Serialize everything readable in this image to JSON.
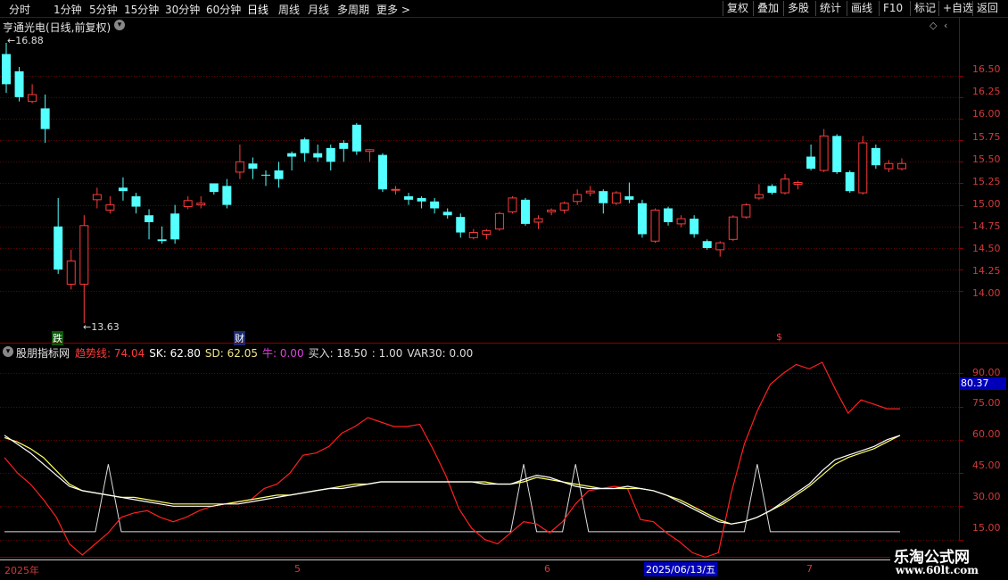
{
  "toolbar": {
    "periods": [
      "分时",
      "1分钟",
      "5分钟",
      "15分钟",
      "30分钟",
      "60分钟",
      "日线",
      "周线",
      "月线",
      "多周期",
      "更多"
    ],
    "active_period": "日线",
    "right_buttons": [
      "复权",
      "叠加",
      "多股",
      "统计",
      "画线",
      "F10",
      "标记",
      "+自选",
      "返回"
    ]
  },
  "header": {
    "title": "亨通光电(日线,前复权)"
  },
  "price_axis": [
    "16.50",
    "16.25",
    "16.00",
    "15.75",
    "15.50",
    "15.25",
    "15.00",
    "14.75",
    "14.50",
    "14.25",
    "14.00"
  ],
  "annotations": {
    "high": "16.88",
    "low": "13.63",
    "chip_die": "跌",
    "chip_cai": "财",
    "chip_s": "$"
  },
  "indicator": {
    "name": "股朋指标网",
    "fields": [
      {
        "label": "趋势线:",
        "value": "74.04",
        "color": "#ff3b3b"
      },
      {
        "label": "SK:",
        "value": "62.80",
        "color": "#ffffff"
      },
      {
        "label": "SD:",
        "value": "62.05",
        "color": "#f0e68c"
      },
      {
        "label": "牛:",
        "value": "0.00",
        "color": "#e040e0"
      },
      {
        "label": "买入:",
        "value": "18.50",
        "color": "#dddddd"
      },
      {
        "label": ":",
        "value": "1.00",
        "color": "#dddddd"
      },
      {
        "label": "VAR30:",
        "value": "0.00",
        "color": "#dddddd"
      }
    ],
    "axis": [
      "90.00",
      "75.00",
      "60.00",
      "45.00",
      "30.00",
      "15.00"
    ],
    "current": "80.37"
  },
  "time_axis": {
    "labels": [
      "2025年",
      "5",
      "6",
      "7"
    ],
    "cursor_date": "2025/06/13/五"
  },
  "watermark": {
    "line1": "乐淘公式网",
    "line2": "www.60lt.com"
  },
  "colors": {
    "up": "#ff3b3b",
    "down": "#54ffff",
    "trend": "#ff2020",
    "sk": "#ffffff",
    "sd": "#ffff66"
  },
  "chart_data": [
    {
      "type": "candlestick",
      "title": "亨通光电(日线,前复权)",
      "ylim": [
        13.6,
        16.9
      ],
      "candles": [
        {
          "o": 16.75,
          "c": 16.4,
          "h": 16.88,
          "l": 16.3
        },
        {
          "o": 16.55,
          "c": 16.25,
          "h": 16.6,
          "l": 16.2
        },
        {
          "o": 16.2,
          "c": 16.28,
          "h": 16.4,
          "l": 16.18
        },
        {
          "o": 16.12,
          "c": 15.88,
          "h": 16.28,
          "l": 15.72
        },
        {
          "o": 14.75,
          "c": 14.25,
          "h": 15.08,
          "l": 14.2
        },
        {
          "o": 14.08,
          "c": 14.35,
          "h": 14.48,
          "l": 14.02
        },
        {
          "o": 14.08,
          "c": 14.76,
          "h": 14.88,
          "l": 13.63
        },
        {
          "o": 15.06,
          "c": 15.12,
          "h": 15.2,
          "l": 14.96
        },
        {
          "o": 14.94,
          "c": 15.0,
          "h": 15.1,
          "l": 14.9
        },
        {
          "o": 15.2,
          "c": 15.16,
          "h": 15.32,
          "l": 15.05
        },
        {
          "o": 15.1,
          "c": 14.98,
          "h": 15.14,
          "l": 14.9
        },
        {
          "o": 14.88,
          "c": 14.8,
          "h": 14.95,
          "l": 14.6
        },
        {
          "o": 14.6,
          "c": 14.58,
          "h": 14.75,
          "l": 14.55
        },
        {
          "o": 14.9,
          "c": 14.6,
          "h": 15.0,
          "l": 14.55
        },
        {
          "o": 14.98,
          "c": 15.05,
          "h": 15.1,
          "l": 14.95
        },
        {
          "o": 15.0,
          "c": 15.02,
          "h": 15.1,
          "l": 14.96
        },
        {
          "o": 15.25,
          "c": 15.15,
          "h": 15.25,
          "l": 15.12
        },
        {
          "o": 15.22,
          "c": 15.0,
          "h": 15.3,
          "l": 14.96
        },
        {
          "o": 15.38,
          "c": 15.5,
          "h": 15.7,
          "l": 15.3
        },
        {
          "o": 15.48,
          "c": 15.42,
          "h": 15.55,
          "l": 15.3
        },
        {
          "o": 15.35,
          "c": 15.34,
          "h": 15.4,
          "l": 15.22
        },
        {
          "o": 15.4,
          "c": 15.3,
          "h": 15.5,
          "l": 15.2
        },
        {
          "o": 15.6,
          "c": 15.56,
          "h": 15.62,
          "l": 15.4
        },
        {
          "o": 15.76,
          "c": 15.6,
          "h": 15.78,
          "l": 15.5
        },
        {
          "o": 15.6,
          "c": 15.55,
          "h": 15.7,
          "l": 15.5
        },
        {
          "o": 15.66,
          "c": 15.5,
          "h": 15.7,
          "l": 15.4
        },
        {
          "o": 15.72,
          "c": 15.65,
          "h": 15.75,
          "l": 15.5
        },
        {
          "o": 15.93,
          "c": 15.62,
          "h": 15.95,
          "l": 15.58
        },
        {
          "o": 15.62,
          "c": 15.64,
          "h": 15.65,
          "l": 15.5
        },
        {
          "o": 15.58,
          "c": 15.18,
          "h": 15.6,
          "l": 15.15
        },
        {
          "o": 15.18,
          "c": 15.18,
          "h": 15.22,
          "l": 15.12
        },
        {
          "o": 15.1,
          "c": 15.06,
          "h": 15.14,
          "l": 15.0
        },
        {
          "o": 15.08,
          "c": 15.04,
          "h": 15.1,
          "l": 14.96
        },
        {
          "o": 15.04,
          "c": 14.96,
          "h": 15.08,
          "l": 14.9
        },
        {
          "o": 14.92,
          "c": 14.88,
          "h": 14.96,
          "l": 14.84
        },
        {
          "o": 14.86,
          "c": 14.68,
          "h": 14.9,
          "l": 14.62
        },
        {
          "o": 14.62,
          "c": 14.68,
          "h": 14.72,
          "l": 14.6
        },
        {
          "o": 14.66,
          "c": 14.7,
          "h": 14.72,
          "l": 14.6
        },
        {
          "o": 14.72,
          "c": 14.9,
          "h": 14.92,
          "l": 14.7
        },
        {
          "o": 14.92,
          "c": 15.08,
          "h": 15.1,
          "l": 14.9
        },
        {
          "o": 15.06,
          "c": 14.78,
          "h": 15.08,
          "l": 14.76
        },
        {
          "o": 14.8,
          "c": 14.84,
          "h": 14.88,
          "l": 14.72
        },
        {
          "o": 14.92,
          "c": 14.94,
          "h": 14.96,
          "l": 14.88
        },
        {
          "o": 14.94,
          "c": 15.02,
          "h": 15.04,
          "l": 14.9
        },
        {
          "o": 15.04,
          "c": 15.12,
          "h": 15.18,
          "l": 15.0
        },
        {
          "o": 15.14,
          "c": 15.16,
          "h": 15.22,
          "l": 15.1
        },
        {
          "o": 15.16,
          "c": 15.02,
          "h": 15.18,
          "l": 14.9
        },
        {
          "o": 15.02,
          "c": 15.14,
          "h": 15.16,
          "l": 15.0
        },
        {
          "o": 15.1,
          "c": 15.06,
          "h": 15.26,
          "l": 15.02
        },
        {
          "o": 15.02,
          "c": 14.66,
          "h": 15.06,
          "l": 14.62
        },
        {
          "o": 14.58,
          "c": 14.94,
          "h": 14.96,
          "l": 14.56
        },
        {
          "o": 14.96,
          "c": 14.8,
          "h": 14.98,
          "l": 14.76
        },
        {
          "o": 14.78,
          "c": 14.84,
          "h": 14.88,
          "l": 14.74
        },
        {
          "o": 14.84,
          "c": 14.66,
          "h": 14.88,
          "l": 14.62
        },
        {
          "o": 14.58,
          "c": 14.5,
          "h": 14.6,
          "l": 14.48
        },
        {
          "o": 14.48,
          "c": 14.56,
          "h": 14.58,
          "l": 14.4
        },
        {
          "o": 14.6,
          "c": 14.86,
          "h": 14.88,
          "l": 14.58
        },
        {
          "o": 14.86,
          "c": 15.0,
          "h": 15.02,
          "l": 14.84
        },
        {
          "o": 15.08,
          "c": 15.12,
          "h": 15.24,
          "l": 15.06
        },
        {
          "o": 15.22,
          "c": 15.14,
          "h": 15.24,
          "l": 15.12
        },
        {
          "o": 15.14,
          "c": 15.3,
          "h": 15.36,
          "l": 15.12
        },
        {
          "o": 15.24,
          "c": 15.26,
          "h": 15.28,
          "l": 15.18
        },
        {
          "o": 15.56,
          "c": 15.42,
          "h": 15.7,
          "l": 15.4
        },
        {
          "o": 15.4,
          "c": 15.8,
          "h": 15.88,
          "l": 15.38
        },
        {
          "o": 15.8,
          "c": 15.38,
          "h": 15.82,
          "l": 15.36
        },
        {
          "o": 15.38,
          "c": 15.16,
          "h": 15.4,
          "l": 15.14
        },
        {
          "o": 15.14,
          "c": 15.72,
          "h": 15.8,
          "l": 15.12
        },
        {
          "o": 15.66,
          "c": 15.46,
          "h": 15.7,
          "l": 15.42
        },
        {
          "o": 15.42,
          "c": 15.48,
          "h": 15.52,
          "l": 15.38
        },
        {
          "o": 15.42,
          "c": 15.48,
          "h": 15.54,
          "l": 15.4
        }
      ]
    },
    {
      "type": "line",
      "title": "股朋指标网",
      "ylim": [
        12,
        97
      ],
      "series": [
        {
          "name": "趋势线",
          "color": "#ff2020",
          "values": [
            52,
            45,
            40,
            33,
            25,
            13,
            8,
            13,
            18,
            25,
            27,
            28,
            25,
            23,
            25,
            28,
            30,
            31,
            32,
            33,
            38,
            40,
            45,
            53,
            54,
            57,
            63,
            66,
            70,
            68,
            66,
            66,
            67,
            56,
            44,
            29,
            20,
            15,
            13,
            18,
            23,
            22,
            18,
            23,
            31,
            37,
            38,
            39,
            38,
            24,
            23,
            18,
            14,
            9,
            7,
            9,
            36,
            58,
            73,
            85,
            90,
            94,
            92,
            95,
            83,
            72,
            78,
            76,
            74,
            74
          ]
        },
        {
          "name": "SK",
          "color": "#ffffff",
          "values": [
            62,
            58,
            54,
            49,
            44,
            39,
            37,
            36,
            35,
            34,
            33,
            32,
            31,
            30,
            30,
            30,
            30,
            31,
            31,
            32,
            33,
            34,
            35,
            36,
            37,
            38,
            38,
            39,
            40,
            41,
            41,
            41,
            41,
            41,
            41,
            41,
            41,
            40,
            40,
            40,
            42,
            44,
            43,
            41,
            39,
            38,
            38,
            38,
            39,
            38,
            37,
            35,
            32,
            29,
            26,
            23,
            22,
            23,
            25,
            28,
            32,
            36,
            40,
            46,
            51,
            53,
            55,
            57,
            60,
            62
          ]
        },
        {
          "name": "SD",
          "color": "#ffff66",
          "values": [
            61,
            59,
            56,
            52,
            46,
            40,
            37,
            36,
            35,
            34,
            34,
            33,
            32,
            31,
            31,
            31,
            31,
            31,
            32,
            33,
            34,
            35,
            35,
            36,
            37,
            38,
            39,
            40,
            40,
            41,
            41,
            41,
            41,
            41,
            41,
            41,
            41,
            41,
            40,
            40,
            41,
            43,
            42,
            41,
            40,
            39,
            38,
            38,
            38,
            38,
            37,
            35,
            33,
            30,
            27,
            24,
            22,
            23,
            25,
            28,
            31,
            35,
            39,
            44,
            49,
            52,
            54,
            56,
            59,
            62
          ]
        },
        {
          "name": "买入",
          "color": "#dddddd",
          "values": [
            18.5,
            18.5,
            18.5,
            18.5,
            18.5,
            18.5,
            18.5,
            18.5,
            49,
            18.5,
            18.5,
            18.5,
            18.5,
            18.5,
            18.5,
            18.5,
            18.5,
            18.5,
            18.5,
            18.5,
            18.5,
            18.5,
            18.5,
            18.5,
            18.5,
            18.5,
            18.5,
            18.5,
            18.5,
            18.5,
            18.5,
            18.5,
            18.5,
            18.5,
            18.5,
            18.5,
            18.5,
            18.5,
            18.5,
            18.5,
            49,
            18.5,
            18.5,
            18.5,
            49,
            18.5,
            18.5,
            18.5,
            18.5,
            18.5,
            18.5,
            18.5,
            18.5,
            18.5,
            18.5,
            18.5,
            18.5,
            18.5,
            49,
            18.5,
            18.5,
            18.5,
            18.5,
            18.5,
            18.5,
            18.5,
            18.5,
            18.5,
            18.5,
            18.5
          ]
        }
      ]
    }
  ]
}
